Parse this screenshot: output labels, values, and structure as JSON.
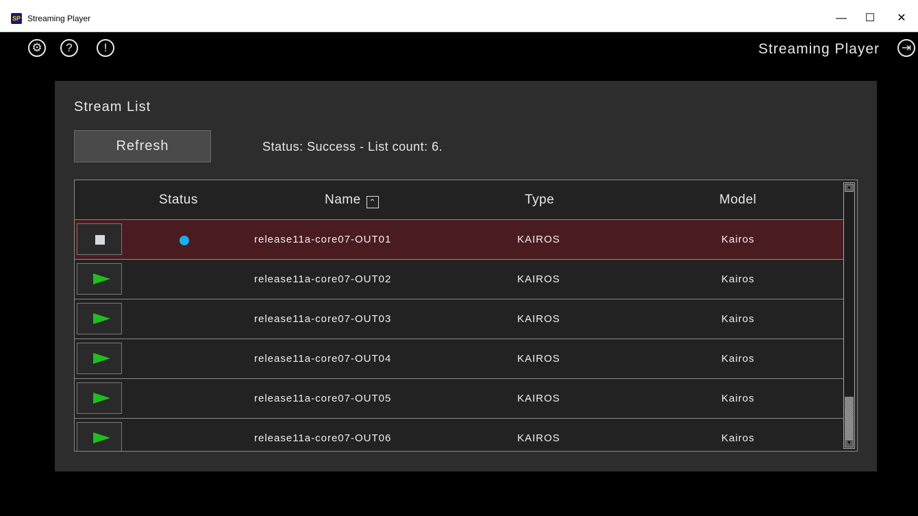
{
  "window": {
    "title": "Streaming Player",
    "icon_text": "SP",
    "minimize_glyph": "—",
    "maximize_glyph": "☐",
    "close_glyph": "✕"
  },
  "toolbar": {
    "icons": [
      "gear-icon",
      "help-icon",
      "info-icon"
    ],
    "help_glyph": "?",
    "info_glyph": "!",
    "gear_glyph": "⚙",
    "app_name": "Streaming Player",
    "exit_glyph": "⇥"
  },
  "stream_list": {
    "title": "Stream List",
    "refresh_label": "Refresh",
    "status_text": "Status: Success - List count: 6.",
    "columns": {
      "status": "Status",
      "name": "Name",
      "type": "Type",
      "model": "Model"
    },
    "sort_glyph": "⌃",
    "rows": [
      {
        "name": "release11a-core07-OUT01",
        "type": "KAIROS",
        "model": "Kairos",
        "playing": true,
        "selected": true
      },
      {
        "name": "release11a-core07-OUT02",
        "type": "KAIROS",
        "model": "Kairos",
        "playing": false,
        "selected": false
      },
      {
        "name": "release11a-core07-OUT03",
        "type": "KAIROS",
        "model": "Kairos",
        "playing": false,
        "selected": false
      },
      {
        "name": "release11a-core07-OUT04",
        "type": "KAIROS",
        "model": "Kairos",
        "playing": false,
        "selected": false
      },
      {
        "name": "release11a-core07-OUT05",
        "type": "KAIROS",
        "model": "Kairos",
        "playing": false,
        "selected": false
      },
      {
        "name": "release11a-core07-OUT06",
        "type": "KAIROS",
        "model": "Kairos",
        "playing": false,
        "selected": false
      }
    ],
    "scroll_up_glyph": "▲",
    "scroll_down_glyph": "▼"
  },
  "colors": {
    "play": "#1fbf1f",
    "status_dot": "#1aaeee",
    "selected_row": "#4a1c20"
  }
}
